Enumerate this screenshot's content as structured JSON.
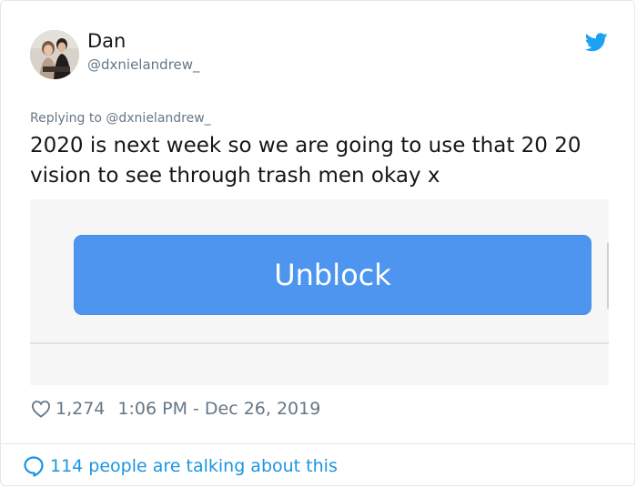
{
  "tweet": {
    "author": {
      "display_name": "Dan",
      "handle": "@dxnielandrew_"
    },
    "replying_to": "Replying to @dxnielandrew_",
    "text": "2020 is next week so we are going to use that 20 20 vision to see through trash men okay x",
    "media": {
      "button_label": "Unblock"
    },
    "likes": "1,274",
    "timestamp": "1:06 PM - Dec 26, 2019",
    "talking": "114 people are talking about this"
  },
  "colors": {
    "brand_blue": "#1da1f2",
    "link_blue": "#1b95e0",
    "button_blue": "#4d95ee",
    "secondary_text": "#657786"
  },
  "icons": [
    "twitter-bird-icon",
    "heart-icon",
    "speech-bubble-icon"
  ]
}
